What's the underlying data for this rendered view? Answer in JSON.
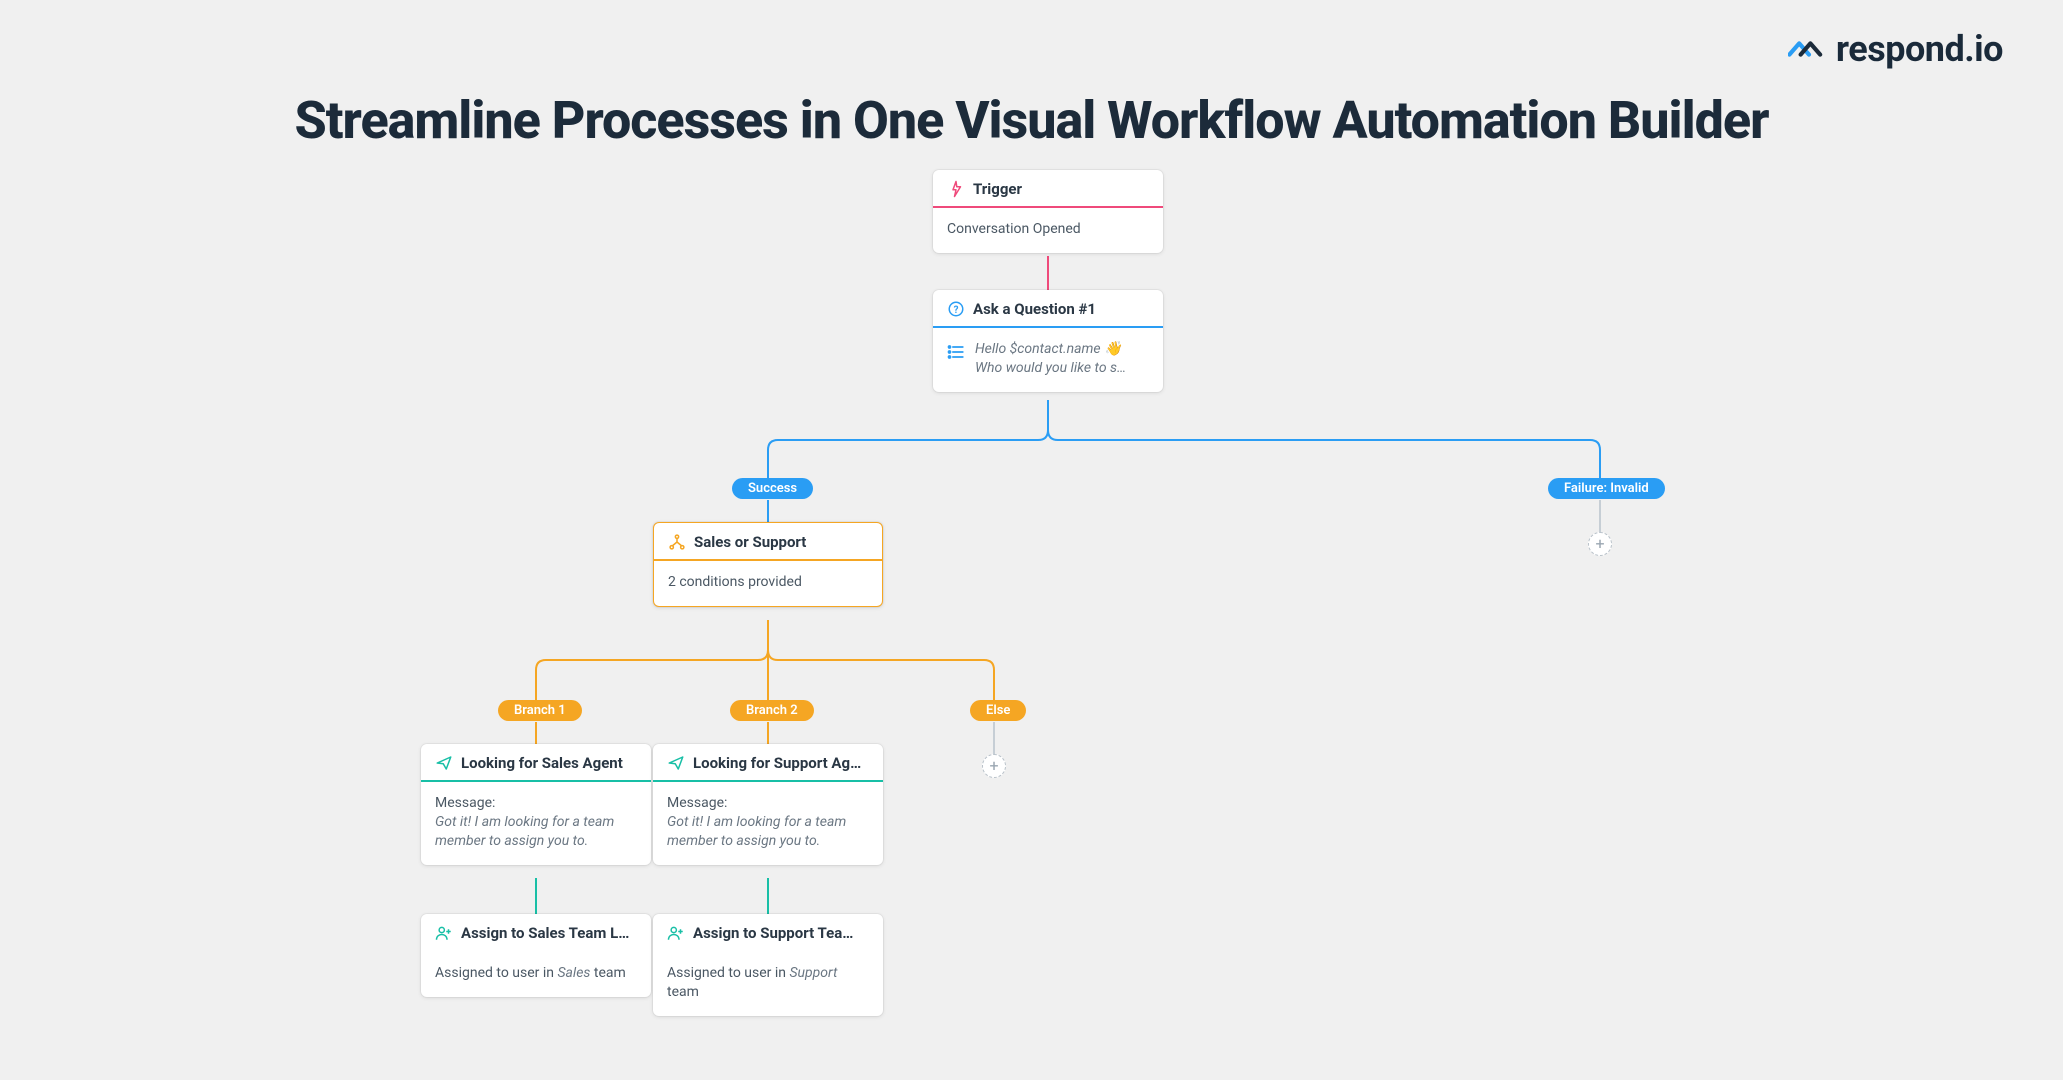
{
  "brand": {
    "name": "respond.io"
  },
  "title": "Streamline Processes in One Visual Workflow Automation Builder",
  "nodes": {
    "trigger": {
      "title": "Trigger",
      "body": "Conversation Opened"
    },
    "ask": {
      "title": "Ask a Question #1",
      "line1": "Hello $contact.name 👋",
      "line2": "Who would you like to s…"
    },
    "branch": {
      "title": "Sales or Support",
      "body": "2 conditions provided"
    },
    "msgSales": {
      "title": "Looking for Sales Agent",
      "label": "Message:",
      "body": "Got it! I am looking for a team member to assign you to."
    },
    "msgSupport": {
      "title": "Looking for Support Age…",
      "label": "Message:",
      "body": "Got it! I am looking for a team member to assign you to."
    },
    "asgSales": {
      "title": "Assign to Sales Team Le…",
      "pre": "Assigned to user in ",
      "team": "Sales",
      "post": " team"
    },
    "asgSupport": {
      "title": "Assign to Support Team…",
      "pre": "Assigned to user in ",
      "team": "Support",
      "post": " team"
    }
  },
  "pills": {
    "success": "Success",
    "failure": "Failure: Invalid",
    "b1": "Branch 1",
    "b2": "Branch 2",
    "else": "Else"
  }
}
